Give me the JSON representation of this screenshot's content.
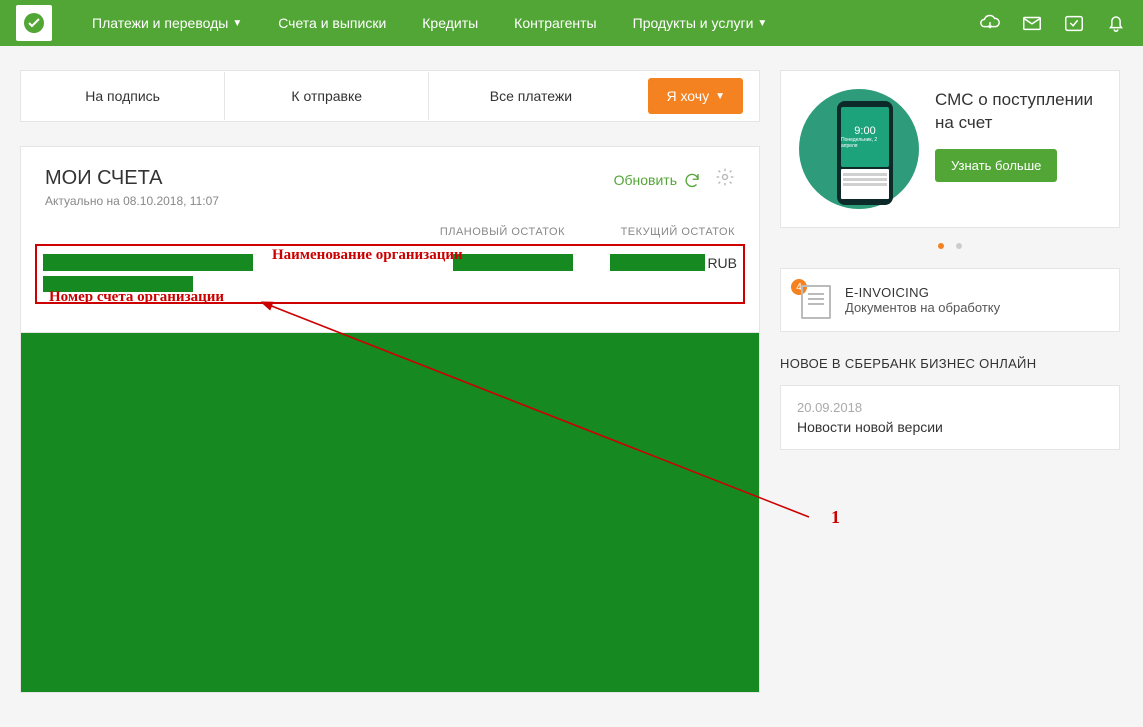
{
  "nav": {
    "items": [
      {
        "label": "Платежи и переводы",
        "dropdown": true
      },
      {
        "label": "Счета и выписки",
        "dropdown": false
      },
      {
        "label": "Кредиты",
        "dropdown": false
      },
      {
        "label": "Контрагенты",
        "dropdown": false
      },
      {
        "label": "Продукты и услуги",
        "dropdown": true
      }
    ]
  },
  "tabs": {
    "items": [
      "На подпись",
      "К отправке",
      "Все платежи"
    ],
    "action_button": "Я хочу"
  },
  "accounts": {
    "title": "МОИ СЧЕТА",
    "subtitle": "Актуально на 08.10.2018, 11:07",
    "refresh": "Обновить",
    "col_plan": "ПЛАНОВЫЙ ОСТАТОК",
    "col_curr": "ТЕКУЩИЙ ОСТАТОК",
    "currency": "RUB"
  },
  "annotations": {
    "org_name": "Наименование организации",
    "acc_num": "Номер счета организации",
    "marker": "1"
  },
  "promo": {
    "title": "СМС о поступлении на счет",
    "button": "Узнать больше",
    "phone_time": "9:00",
    "phone_sub": "Понедельник, 2 апреля"
  },
  "einvoice": {
    "badge": "4",
    "title": "E-INVOICING",
    "subtitle": "Документов на обработку"
  },
  "news": {
    "heading": "НОВОЕ В СБЕРБАНК БИЗНЕС ОНЛАЙН",
    "items": [
      {
        "date": "20.09.2018",
        "title": "Новости новой версии"
      }
    ]
  }
}
